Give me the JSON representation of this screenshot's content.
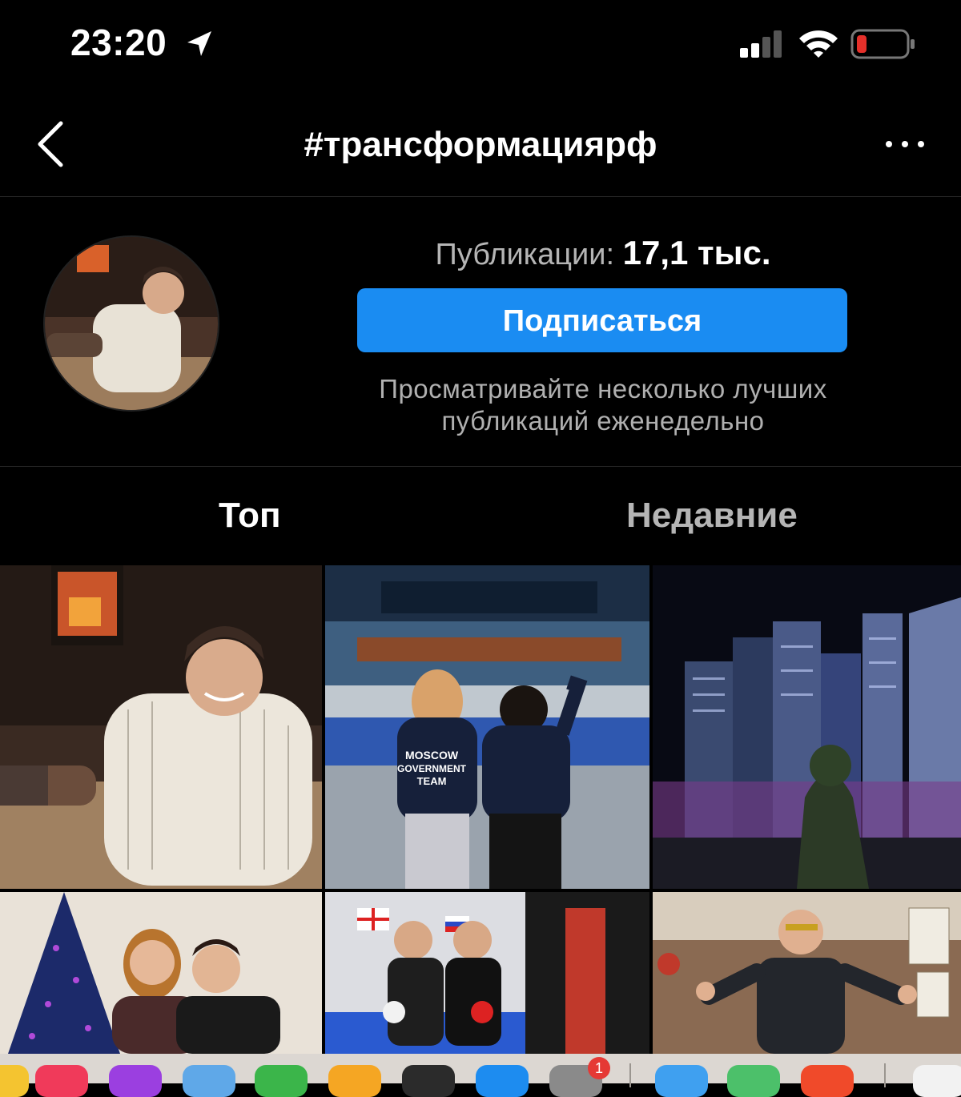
{
  "status_bar": {
    "time": "23:20",
    "icons": [
      "location-arrow-icon",
      "cellular-signal-icon",
      "wifi-icon",
      "battery-low-icon"
    ],
    "battery_color": "#e5302a"
  },
  "nav": {
    "title": "#трансформациярф",
    "back_icon": "chevron-left-icon",
    "more_icon": "more-horizontal-icon"
  },
  "header": {
    "stats_label": "Публикации:",
    "stats_value": "17,1 тыс.",
    "follow_label": "Подписаться",
    "description": "Просматривайте несколько лучших публикаций еженедельно"
  },
  "tabs": {
    "top_label": "Топ",
    "recent_label": "Недавние"
  },
  "colors": {
    "accent": "#1a8cf2",
    "background": "#000000",
    "muted_text": "#b5b5b5"
  },
  "grid": {
    "posts": [
      {
        "name": "post-man-white-shirt"
      },
      {
        "name": "post-moscow-government-team"
      },
      {
        "name": "post-moscow-city-night"
      },
      {
        "name": "post-couple-christmas-tree"
      },
      {
        "name": "post-boxing-gym"
      },
      {
        "name": "post-man-thumbs-up"
      }
    ],
    "shirt_text": [
      "MOSCOW",
      "GOVERNMENT",
      "TEAM"
    ]
  },
  "dock": {
    "badge_count": "1",
    "icons": [
      "music-icon",
      "podcasts-icon",
      "preview-icon",
      "numbers-icon",
      "pages-icon",
      "terminal-icon",
      "xcode-icon",
      "settings-icon",
      "safari-icon",
      "maps-icon",
      "brave-icon",
      "file-icon"
    ]
  }
}
